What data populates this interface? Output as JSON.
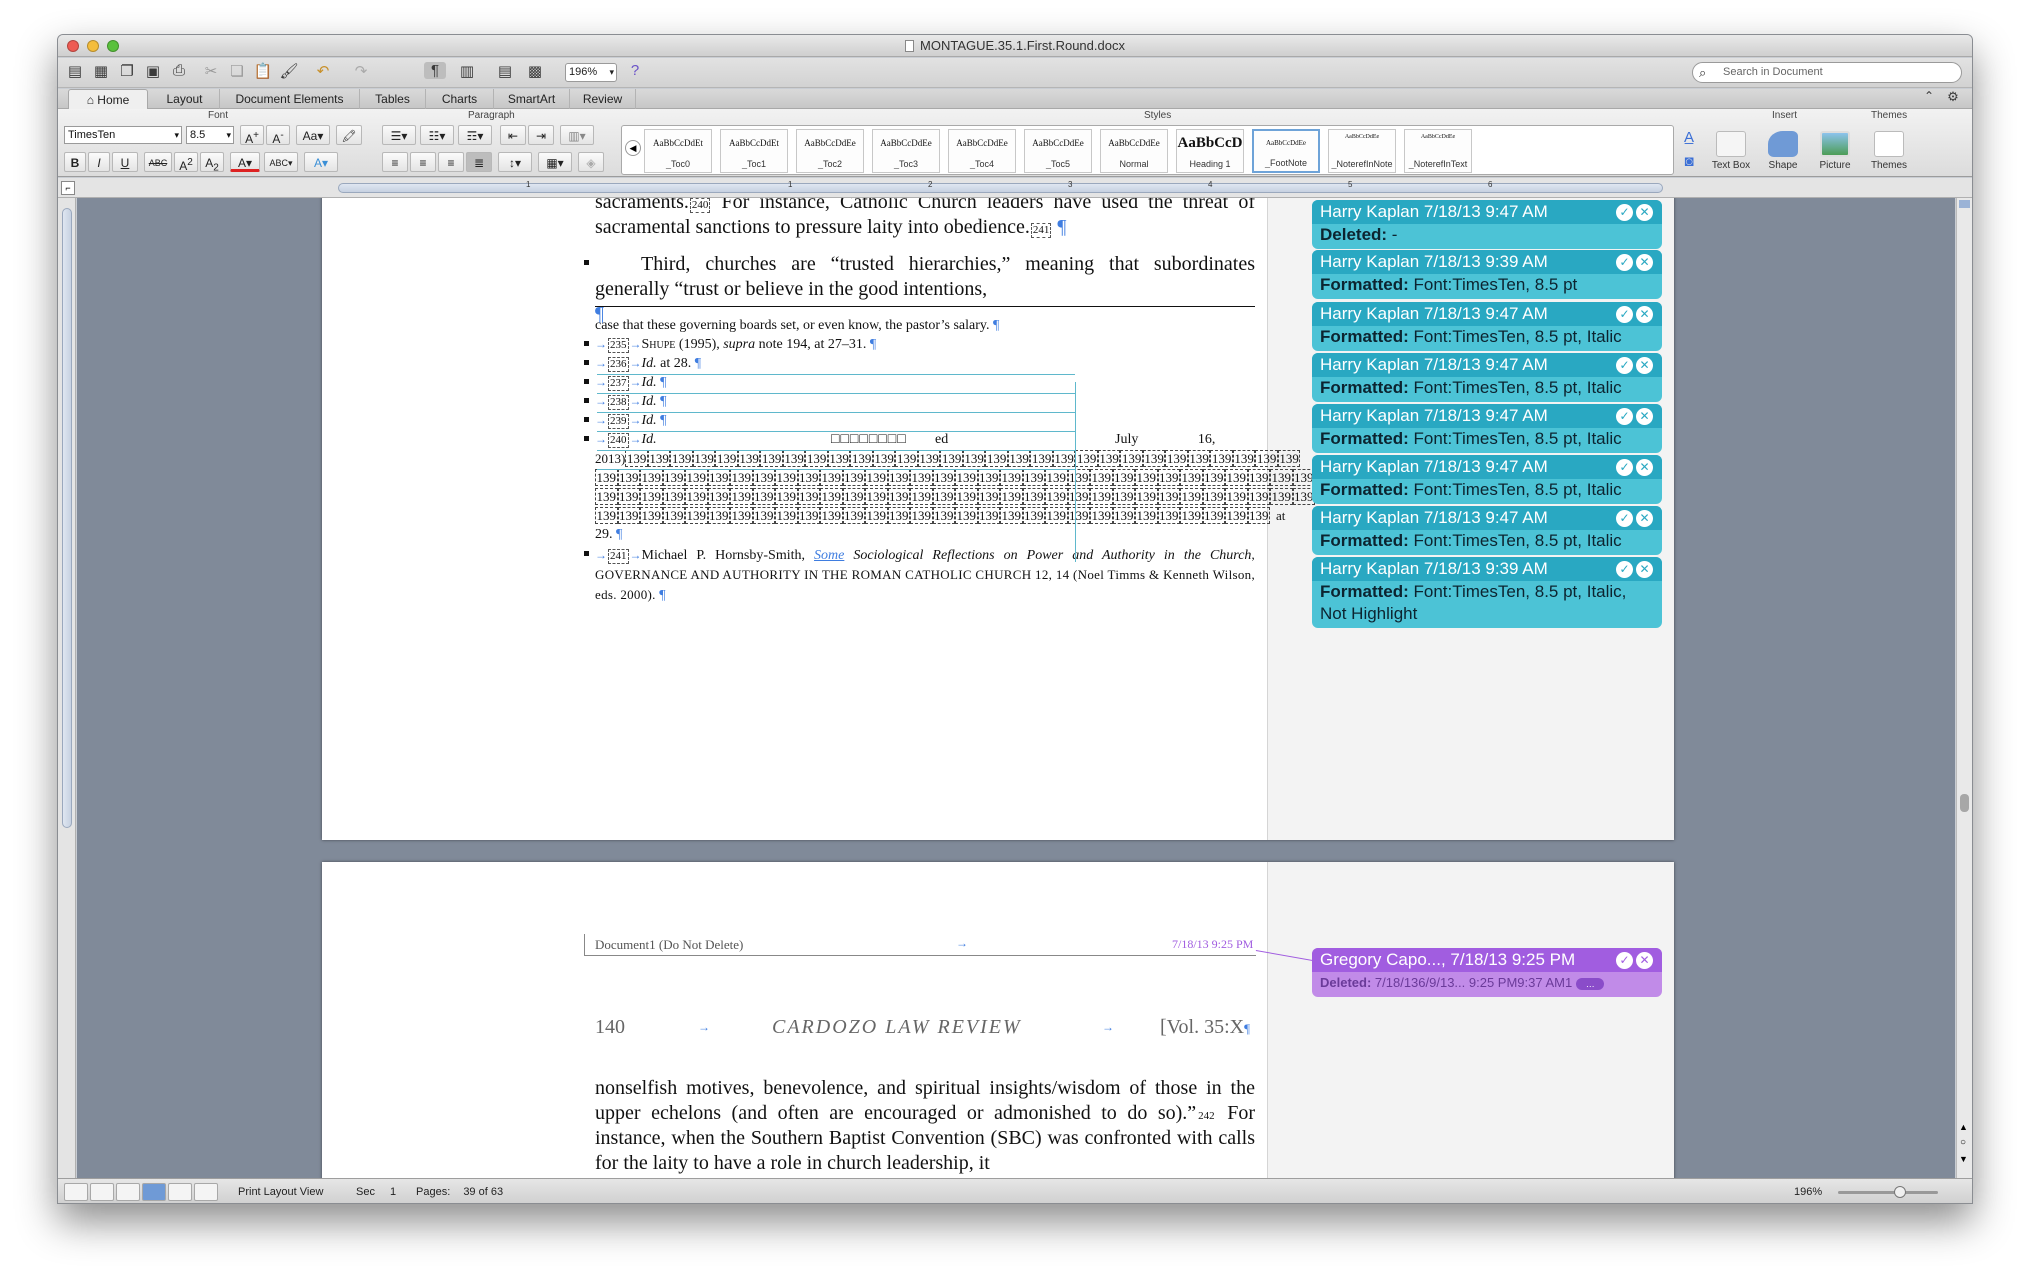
{
  "window": {
    "title": "MONTAGUE.35.1.First.Round.docx"
  },
  "toolbar": {
    "zoom": "196%",
    "search_placeholder": "Search in Document"
  },
  "ribbon_tabs": [
    "Home",
    "Layout",
    "Document Elements",
    "Tables",
    "Charts",
    "SmartArt",
    "Review"
  ],
  "ribbon": {
    "groups": {
      "font": "Font",
      "paragraph": "Paragraph",
      "styles": "Styles",
      "insert": "Insert",
      "themes": "Themes"
    },
    "font_name": "TimesTen",
    "font_size": "8.5",
    "styles": [
      {
        "sample": "AaBbCcDdEt",
        "name": "_Toc0"
      },
      {
        "sample": "AaBbCcDdEt",
        "name": "_Toc1"
      },
      {
        "sample": "AaBbCcDdEe",
        "name": "_Toc2"
      },
      {
        "sample": "AaBbCcDdEe",
        "name": "_Toc3"
      },
      {
        "sample": "AaBbCcDdEe",
        "name": "_Toc4"
      },
      {
        "sample": "AaBbCcDdEe",
        "name": "_Toc5"
      },
      {
        "sample": "AaBbCcDdEe",
        "name": "Normal"
      },
      {
        "sample": "AaBbCcD",
        "name": "Heading 1"
      },
      {
        "sample": "AaBbCcDdEe",
        "name": "_FootNote"
      },
      {
        "sample": "AaBbCcDdEe",
        "name": "_NoterefInNote"
      },
      {
        "sample": "AaBbCcDdEe",
        "name": "_NoterefInText"
      }
    ],
    "insert_items": [
      "Text Box",
      "Shape",
      "Picture"
    ],
    "themes_item": "Themes"
  },
  "document": {
    "page1_body": [
      "sacraments.",
      "For instance, Catholic Church leaders have used the threat of sacramental sanctions to pressure laity into obedience.",
      "Third, churches are “trusted hierarchies,” meaning that subordinates generally “trust or believe in the good intentions,"
    ],
    "footnote_continued": "case that these governing boards set, or even know, the pastor’s salary.",
    "footnotes": [
      {
        "num": "235",
        "text_sc": "Shupe",
        "text": " (1995), ",
        "italic": "supra",
        "rest": " note 194, at 27–31."
      },
      {
        "num": "236",
        "italic": "Id.",
        "rest": " at 28."
      },
      {
        "num": "237",
        "italic": "Id.",
        "rest": ""
      },
      {
        "num": "238",
        "italic": "Id.",
        "rest": ""
      },
      {
        "num": "239",
        "italic": "Id.",
        "rest": ""
      },
      {
        "num": "240",
        "italic": "Id.",
        "rest": ""
      }
    ],
    "fn240_tail": "ed",
    "fn240_date": "July 16,",
    "fn240_year": "2013)",
    "box_token": "139",
    "fn240_end": "at 28-",
    "fn240_end2": "29.",
    "fn241": {
      "num": "241",
      "author": "Michael P. Hornsby-Smith, ",
      "some": "Some",
      "title": " Sociological Reflections on Power and Authority in the Church",
      "book": ", GOVERNANCE AND AUTHORITY IN THE ROMAN CATHOLIC CHURCH 12, 14 (Noel Timms & Kenneth Wilson, eds. 2000)."
    },
    "header_left": "Document1 (Do Not Delete)",
    "header_date": "7/18/13 9:25 PM",
    "page_number": "140",
    "running_title": "CARDOZO LAW REVIEW",
    "vol": "[Vol. 35:X",
    "page2_body": "nonselfish motives, benevolence, and spiritual insights/wisdom of those in the upper echelons (and often are encouraged or admonished to do so).”",
    "page2_fn": "242",
    "page2_body2": " For instance, when the Southern Baptist Convention (SBC) was confronted with calls for the laity to have a role in church leadership, it"
  },
  "comments": [
    {
      "author": "Harry Kaplan 7/18/13 9:47 AM",
      "label": "Deleted:",
      "detail": " -"
    },
    {
      "author": "Harry Kaplan 7/18/13 9:39 AM",
      "label": "Formatted:",
      "detail": " Font:TimesTen, 8.5 pt"
    },
    {
      "author": "Harry Kaplan 7/18/13 9:47 AM",
      "label": "Formatted:",
      "detail": " Font:TimesTen, 8.5 pt, Italic"
    },
    {
      "author": "Harry Kaplan 7/18/13 9:47 AM",
      "label": "Formatted:",
      "detail": " Font:TimesTen, 8.5 pt, Italic"
    },
    {
      "author": "Harry Kaplan 7/18/13 9:47 AM",
      "label": "Formatted:",
      "detail": " Font:TimesTen, 8.5 pt, Italic"
    },
    {
      "author": "Harry Kaplan 7/18/13 9:47 AM",
      "label": "Formatted:",
      "detail": " Font:TimesTen, 8.5 pt, Italic"
    },
    {
      "author": "Harry Kaplan 7/18/13 9:47 AM",
      "label": "Formatted:",
      "detail": " Font:TimesTen, 8.5 pt, Italic"
    },
    {
      "author": "Harry Kaplan 7/18/13 9:39 AM",
      "label": "Formatted:",
      "detail": " Font:TimesTen, 8.5 pt, Italic, Not Highlight"
    }
  ],
  "comment2": {
    "author": "Gregory Capo..., 7/18/13 9:25 PM",
    "label": "Deleted:",
    "detail": " 7/18/136/9/13... 9:25 PM9:37 AM1"
  },
  "status": {
    "view": "Print Layout View",
    "sec_label": "Sec",
    "sec": "1",
    "pages_label": "Pages:",
    "pages": "39 of 63",
    "zoom": "196%"
  },
  "colors": {
    "balloon_teal": "#4cc3d6",
    "balloon_purple": "#a15de0",
    "accent": "#3f7de0"
  }
}
